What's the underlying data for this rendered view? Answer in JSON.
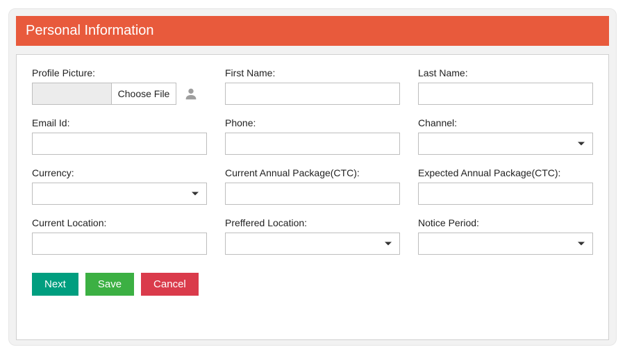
{
  "header": {
    "title": "Personal Information"
  },
  "fields": {
    "profile_picture": {
      "label": "Profile Picture:",
      "button": "Choose File",
      "value": ""
    },
    "first_name": {
      "label": "First Name:",
      "value": ""
    },
    "last_name": {
      "label": "Last Name:",
      "value": ""
    },
    "email": {
      "label": "Email Id:",
      "value": ""
    },
    "phone": {
      "label": "Phone:",
      "value": ""
    },
    "channel": {
      "label": "Channel:",
      "value": ""
    },
    "currency": {
      "label": "Currency:",
      "value": ""
    },
    "current_ctc": {
      "label": "Current Annual Package(CTC):",
      "value": ""
    },
    "expected_ctc": {
      "label": "Expected Annual Package(CTC):",
      "value": ""
    },
    "current_location": {
      "label": "Current Location:",
      "value": ""
    },
    "preferred_location": {
      "label": "Preffered Location:",
      "value": ""
    },
    "notice_period": {
      "label": "Notice Period:",
      "value": ""
    }
  },
  "buttons": {
    "next": "Next",
    "save": "Save",
    "cancel": "Cancel"
  },
  "colors": {
    "header_bg": "#e85a3c",
    "next": "#009e7f",
    "save": "#3cb043",
    "cancel": "#da3b4b"
  }
}
